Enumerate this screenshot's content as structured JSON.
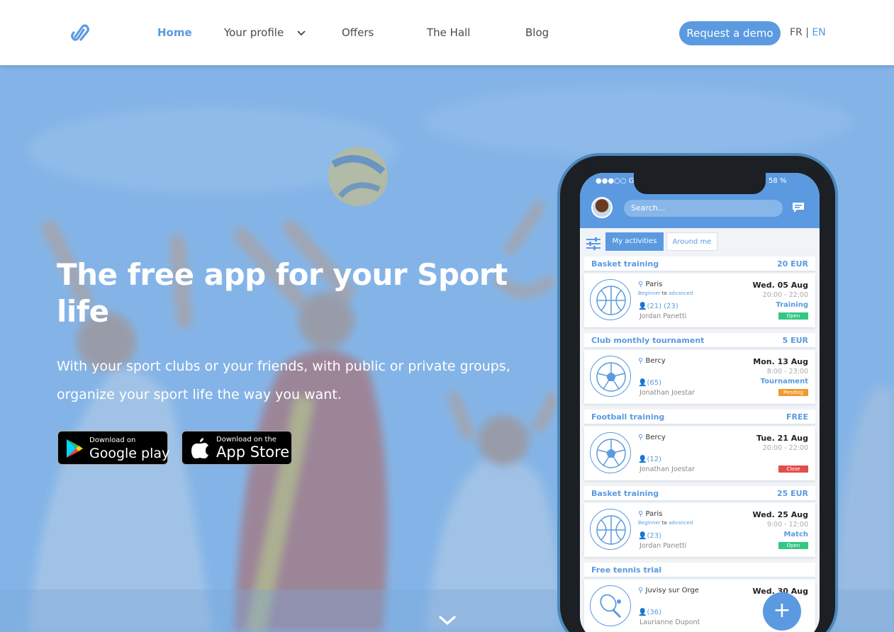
{
  "nav": {
    "links": [
      "Home",
      "Your profile",
      "Offers",
      "The Hall",
      "Blog"
    ],
    "demo": "Request a demo",
    "lang_fr": "FR",
    "lang_sep": "|",
    "lang_en": "EN"
  },
  "hero": {
    "title": "The free app for your Sport life",
    "subtitle": "With your sport clubs or your friends, with public or private groups, organize your sport life the way you want.",
    "google_small": "Download on",
    "google_big": "Google play",
    "apple_small": "Download on the",
    "apple_big": "App Store"
  },
  "phone": {
    "carrier": "●●●○○ GS",
    "battery": "58 %",
    "search": "Search...",
    "tab_mine": "My activities",
    "tab_around": "Around me",
    "fab": "+",
    "cards": [
      {
        "title": "Basket training",
        "price": "20 EUR",
        "location": "Paris",
        "level_a": "Beginner",
        "level_to": "to",
        "level_b": "advanced",
        "players": "(21)  (23)",
        "host": "Jordan Panetti",
        "date": "Wed. 05 Aug",
        "time": "20:00 - 22:00",
        "kind": "Training",
        "status": "Open",
        "sport": "basketball"
      },
      {
        "title": "Club monthly tournament",
        "price": "5 EUR",
        "location": "Bercy",
        "level_a": "",
        "level_to": "",
        "level_b": "",
        "players": "(65)",
        "host": "Jonathan Joestar",
        "date": "Mon. 13 Aug",
        "time": "8:00 - 23:00",
        "kind": "Tournament",
        "status": "Pending",
        "sport": "football"
      },
      {
        "title": "Football training",
        "price": "FREE",
        "location": "Bercy",
        "level_a": "",
        "level_to": "",
        "level_b": "",
        "players": "(12)",
        "host": "Jonathan Joestar",
        "date": "Tue. 21 Aug",
        "time": "20:00 - 22:00",
        "kind": "",
        "status": "Close",
        "sport": "football"
      },
      {
        "title": "Basket training",
        "price": "25 EUR",
        "location": "Paris",
        "level_a": "Beginner",
        "level_to": "to",
        "level_b": "advanced",
        "players": "(23)",
        "host": "Jordan Panetti",
        "date": "Wed. 25 Aug",
        "time": "9:00 - 12:00",
        "kind": "Match",
        "status": "Open",
        "sport": "basketball"
      },
      {
        "title": "Free tennis trial",
        "price": "",
        "location": "Juvisy sur Orge",
        "level_a": "",
        "level_to": "",
        "level_b": "",
        "players": "(36)",
        "host": "Laurianne Dupont",
        "date": "Wed. 30 Aug",
        "time": "",
        "kind": "",
        "status": "",
        "sport": "tennis"
      }
    ]
  },
  "colors": {
    "accent": "#5b9ae0",
    "open": "#32c882",
    "pending": "#ef9a2e",
    "close": "#e44d4d"
  },
  "icons": [
    "logo-icon",
    "chevron-down-icon",
    "google-play-icon",
    "apple-icon",
    "message-icon",
    "filter-icon",
    "location-pin-icon",
    "user-icon",
    "scroll-down-icon"
  ]
}
